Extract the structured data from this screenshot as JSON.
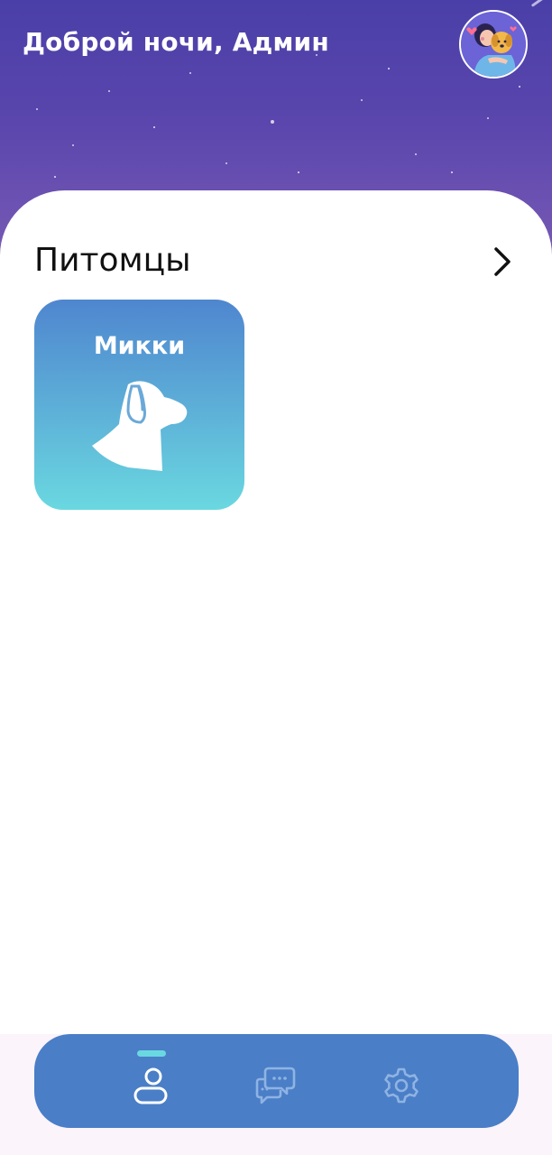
{
  "header": {
    "greeting": "Доброй ночи, Админ"
  },
  "pets_section": {
    "title": "Питомцы",
    "items": [
      {
        "name": "Микки",
        "icon": "dog-head-icon"
      }
    ]
  },
  "bottom_nav": {
    "items": [
      {
        "icon": "profile-icon",
        "active": true
      },
      {
        "icon": "chat-icon",
        "active": false
      },
      {
        "icon": "settings-icon",
        "active": false
      }
    ]
  },
  "colors": {
    "header_top": "#4a3fa8",
    "header_bottom": "#7a5bb5",
    "pet_card_top": "#4f86cf",
    "pet_card_bottom": "#6ad8e0",
    "nav_bg": "#4a7ec7",
    "nav_active_indicator": "#6ad8e0",
    "nav_inactive_icon": "#8fb3e3"
  }
}
